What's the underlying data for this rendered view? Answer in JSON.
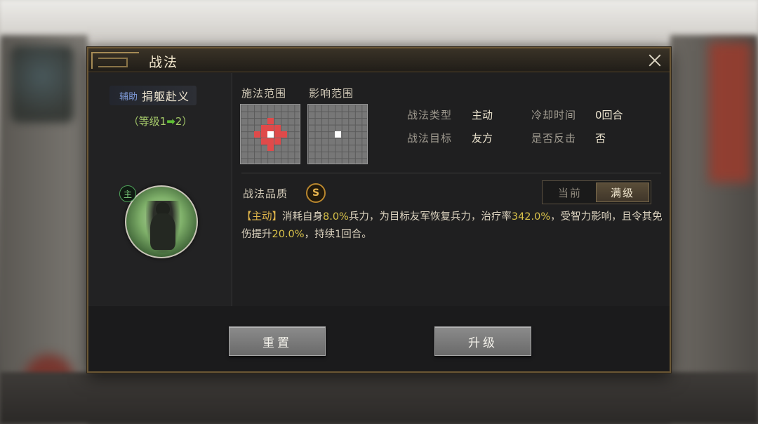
{
  "dialog": {
    "title": "战法",
    "close_icon": "close-icon"
  },
  "skill": {
    "tag": "辅助",
    "name": "捐躯赴义",
    "level_prefix": "（等级1",
    "level_arrow": "➡",
    "level_suffix": "2）",
    "role_badge": "主"
  },
  "ranges": {
    "cast_label": "施法范围",
    "effect_label": "影响范围"
  },
  "info": {
    "type_label": "战法类型",
    "type_value": "主动",
    "target_label": "战法目标",
    "target_value": "友方",
    "cooldown_label": "冷却时间",
    "cooldown_value": "0回合",
    "counter_label": "是否反击",
    "counter_value": "否"
  },
  "quality": {
    "label": "战法品质",
    "grade": "S"
  },
  "toggle": {
    "current": "当前",
    "max": "满级"
  },
  "description": {
    "tag": "【主动】",
    "p1": "消耗自身",
    "n1": "8.0%",
    "p2": "兵力，为目标友军恢复兵力，治疗率",
    "n2": "342.0%",
    "p3": "，受智力影响，且令其免伤提升",
    "n3": "20.0%",
    "p4": "，持续1回合。"
  },
  "buttons": {
    "reset": "重置",
    "upgrade": "升级"
  },
  "colors": {
    "accent_gold": "#e0b64b",
    "level_green": "#a5c96a",
    "range_red": "#e04a4a"
  }
}
